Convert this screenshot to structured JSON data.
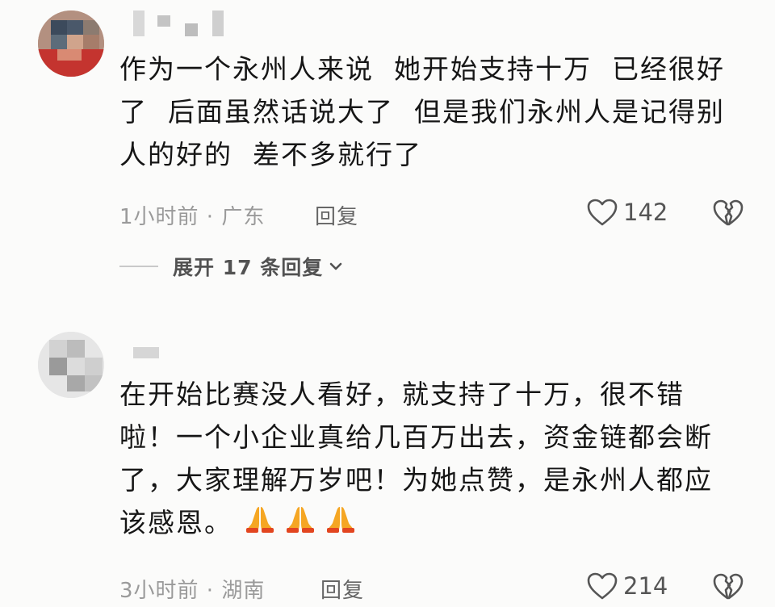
{
  "comments": [
    {
      "username": "",
      "text": "作为一个永州人来说  她开始支持十万  已经很好\n了  后面虽然话说大了  但是我们永州人是记得别\n人的好的  差不多就行了",
      "time_location": "1小时前 · 广东",
      "reply_label": "回复",
      "likes": "142",
      "expand_replies_label": "展开 17 条回复"
    },
    {
      "username": "",
      "text": "在开始比赛没人看好，就支持了十万，很不错\n啦！一个小企业真给几百万出去，资金链都会断\n了，大家理解万岁吧！为她点赞，是永州人都应\n该感恩。",
      "emoji_count": 3,
      "emoji_name": "folded-hands-icon",
      "time_location": "3小时前 · 湖南",
      "reply_label": "回复",
      "likes": "214"
    }
  ],
  "colors": {
    "background": "#fbfbfa",
    "text": "#161616",
    "meta": "#9a9a9a",
    "emoji": "#f5a623"
  }
}
